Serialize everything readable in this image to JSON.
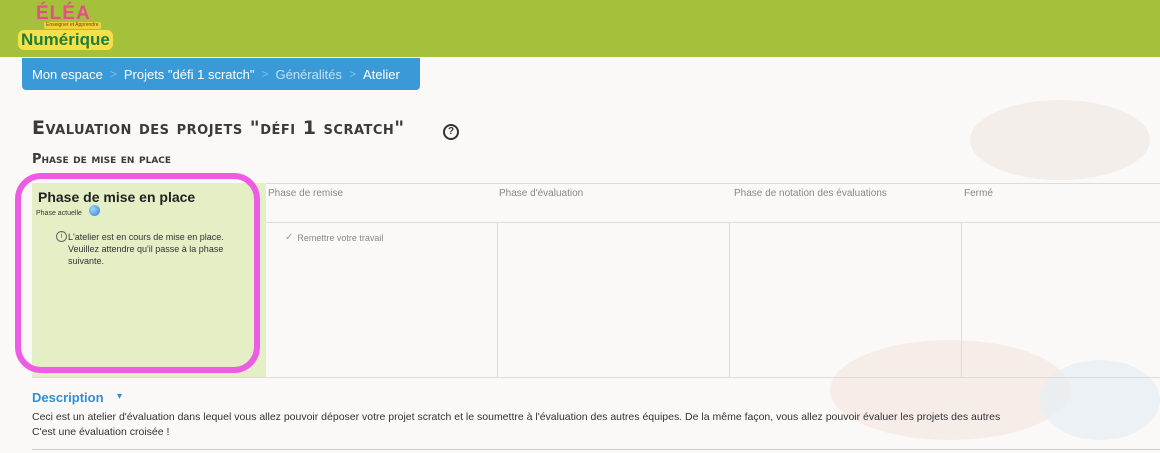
{
  "logo": {
    "line1": "ÉLÉA",
    "tagline": "Enseigner et Apprendre",
    "line2": "Numérique"
  },
  "breadcrumb": {
    "items": [
      "Mon espace",
      "Projets \"défi 1 scratch\"",
      "Généralités",
      "Atelier"
    ],
    "separator": ">"
  },
  "page": {
    "title": "Evaluation des projets \"défi 1 scratch\"",
    "help": "?",
    "phase_title": "Phase de mise en place"
  },
  "phases": {
    "current": {
      "title": "Phase de mise en place",
      "subtitle": "Phase actuelle",
      "info": "i",
      "message_lines": [
        "L'atelier est en cours de mise en place.",
        "Veuillez attendre qu'il passe à la phase",
        "suivante."
      ]
    },
    "headers": [
      "Phase de remise",
      "Phase d'évaluation",
      "Phase de notation des évaluations",
      "Fermé"
    ],
    "task": "Remettre votre travail",
    "task_icon": "✓"
  },
  "description": {
    "title": "Description",
    "caret": "▾",
    "line1": "Ceci est un atelier d'évaluation dans lequel vous allez pouvoir déposer votre projet scratch et le soumettre à l'évaluation des autres équipes. De la même façon, vous allez pouvoir évaluer les projets des autres",
    "line2": "C'est une évaluation croisée !"
  },
  "colors": {
    "topbar": "#a5c03a",
    "breadcrumb": "#3a9ad8",
    "current_phase": "#e5efc5",
    "highlight": "#ee5ce6"
  }
}
